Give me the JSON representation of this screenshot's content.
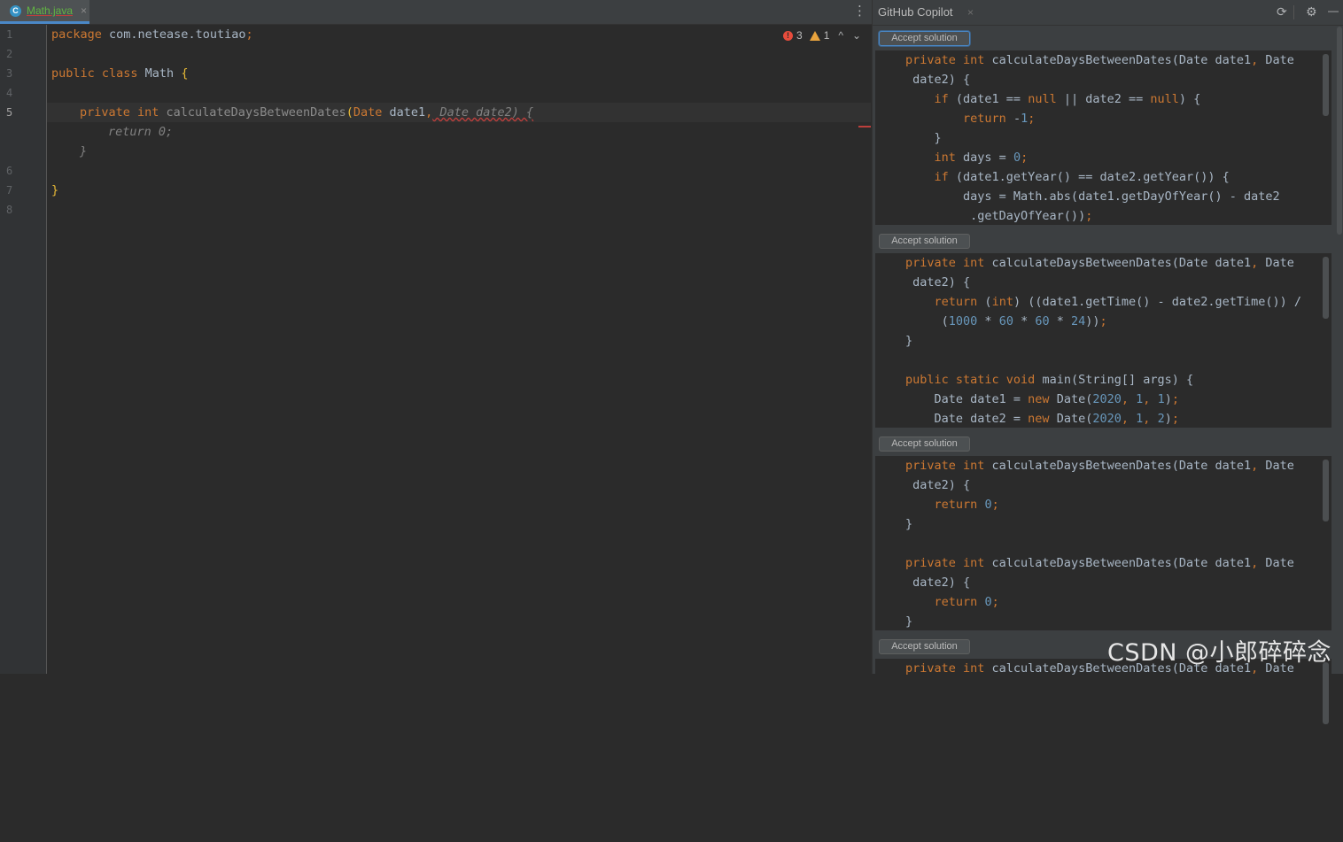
{
  "editor": {
    "tab": {
      "icon_letter": "C",
      "label": "Math.java",
      "close": "×"
    },
    "menu_glyph": "⋮",
    "line_numbers": [
      "1",
      "2",
      "3",
      "4",
      "5",
      "",
      "",
      "6",
      "7",
      "8"
    ],
    "lines": {
      "l1_kw": "package",
      "l1_rest": " com.netease.toutiao",
      "l1_semi": ";",
      "l3_kw": "public class",
      "l3_name": " Math ",
      "l3_brace": "{",
      "l5_kw": "private int",
      "l5_fn": " calculateDaysBetweenDates",
      "l5_paren": "(",
      "l5_type1": "Date",
      "l5_p1": " date1",
      "l5_comma": ",",
      "l5_ghost": " Date date2) {",
      "ghost_return": "return 0;",
      "ghost_close": "}",
      "l7_brace": "}"
    },
    "inspection": {
      "errors": "3",
      "warnings": "1",
      "up": "^",
      "down": "⌄",
      "error_glyph": "!"
    }
  },
  "copilot": {
    "title": "GitHub Copilot",
    "close": "×",
    "icons": {
      "refresh": "⟳",
      "settings": "⚙",
      "minimize": "—"
    },
    "accept_label": "Accept solution",
    "solutions": [
      {
        "lines": [
          [
            [
              "kw",
              "private int"
            ],
            [
              "t",
              " calculateDaysBetweenDates(Date date1"
            ],
            [
              "sc",
              ","
            ],
            [
              "t",
              " Date"
            ]
          ],
          [
            [
              "t",
              " date2) {"
            ]
          ],
          [
            [
              "t",
              "    "
            ],
            [
              "kw",
              "if"
            ],
            [
              "t",
              " (date1 == "
            ],
            [
              "kw",
              "null"
            ],
            [
              "t",
              " || date2 == "
            ],
            [
              "kw",
              "null"
            ],
            [
              "t",
              ") {"
            ]
          ],
          [
            [
              "t",
              "        "
            ],
            [
              "kw",
              "return"
            ],
            [
              "t",
              " -"
            ],
            [
              "num",
              "1"
            ],
            [
              "sc",
              ";"
            ]
          ],
          [
            [
              "t",
              "    }"
            ]
          ],
          [
            [
              "t",
              "    "
            ],
            [
              "kw",
              "int"
            ],
            [
              "t",
              " days = "
            ],
            [
              "num",
              "0"
            ],
            [
              "sc",
              ";"
            ]
          ],
          [
            [
              "t",
              "    "
            ],
            [
              "kw",
              "if"
            ],
            [
              "t",
              " (date1.getYear() == date2.getYear()) {"
            ]
          ],
          [
            [
              "t",
              "        days = Math.abs(date1.getDayOfYear() - date2"
            ]
          ],
          [
            [
              "t",
              "         .getDayOfYear())"
            ],
            [
              "sc",
              ";"
            ]
          ]
        ]
      },
      {
        "lines": [
          [
            [
              "kw",
              "private int"
            ],
            [
              "t",
              " calculateDaysBetweenDates(Date date1"
            ],
            [
              "sc",
              ","
            ],
            [
              "t",
              " Date"
            ]
          ],
          [
            [
              "t",
              " date2) {"
            ]
          ],
          [
            [
              "t",
              "    "
            ],
            [
              "kw",
              "return"
            ],
            [
              "t",
              " ("
            ],
            [
              "kw",
              "int"
            ],
            [
              "t",
              ") ((date1.getTime() - date2.getTime()) /"
            ]
          ],
          [
            [
              "t",
              "     ("
            ],
            [
              "num",
              "1000"
            ],
            [
              "t",
              " * "
            ],
            [
              "num",
              "60"
            ],
            [
              "t",
              " * "
            ],
            [
              "num",
              "60"
            ],
            [
              "t",
              " * "
            ],
            [
              "num",
              "24"
            ],
            [
              "t",
              "))"
            ],
            [
              "sc",
              ";"
            ]
          ],
          [
            [
              "t",
              "}"
            ]
          ],
          [
            [
              "t",
              ""
            ]
          ],
          [
            [
              "kw",
              "public static void"
            ],
            [
              "t",
              " main(String[] args) {"
            ]
          ],
          [
            [
              "t",
              "    Date date1 = "
            ],
            [
              "kw",
              "new"
            ],
            [
              "t",
              " Date("
            ],
            [
              "num",
              "2020"
            ],
            [
              "sc",
              ","
            ],
            [
              "t",
              " "
            ],
            [
              "num",
              "1"
            ],
            [
              "sc",
              ","
            ],
            [
              "t",
              " "
            ],
            [
              "num",
              "1"
            ],
            [
              "t",
              ")"
            ],
            [
              "sc",
              ";"
            ]
          ],
          [
            [
              "t",
              "    Date date2 = "
            ],
            [
              "kw",
              "new"
            ],
            [
              "t",
              " Date("
            ],
            [
              "num",
              "2020"
            ],
            [
              "sc",
              ","
            ],
            [
              "t",
              " "
            ],
            [
              "num",
              "1"
            ],
            [
              "sc",
              ","
            ],
            [
              "t",
              " "
            ],
            [
              "num",
              "2"
            ],
            [
              "t",
              ")"
            ],
            [
              "sc",
              ";"
            ]
          ]
        ]
      },
      {
        "lines": [
          [
            [
              "kw",
              "private int"
            ],
            [
              "t",
              " calculateDaysBetweenDates(Date date1"
            ],
            [
              "sc",
              ","
            ],
            [
              "t",
              " Date"
            ]
          ],
          [
            [
              "t",
              " date2) {"
            ]
          ],
          [
            [
              "t",
              "    "
            ],
            [
              "kw",
              "return"
            ],
            [
              "t",
              " "
            ],
            [
              "num",
              "0"
            ],
            [
              "sc",
              ";"
            ]
          ],
          [
            [
              "t",
              "}"
            ]
          ],
          [
            [
              "t",
              ""
            ]
          ],
          [
            [
              "kw",
              "private int"
            ],
            [
              "t",
              " calculateDaysBetweenDates(Date date1"
            ],
            [
              "sc",
              ","
            ],
            [
              "t",
              " Date"
            ]
          ],
          [
            [
              "t",
              " date2) {"
            ]
          ],
          [
            [
              "t",
              "    "
            ],
            [
              "kw",
              "return"
            ],
            [
              "t",
              " "
            ],
            [
              "num",
              "0"
            ],
            [
              "sc",
              ";"
            ]
          ],
          [
            [
              "t",
              "}"
            ]
          ]
        ]
      },
      {
        "lines": [
          [
            [
              "kw",
              "private int"
            ],
            [
              "t",
              " calculateDaysBetweenDates(Date date1"
            ],
            [
              "sc",
              ","
            ],
            [
              "t",
              " Date"
            ]
          ]
        ]
      }
    ]
  },
  "watermark": "CSDN @小郎碎碎念"
}
